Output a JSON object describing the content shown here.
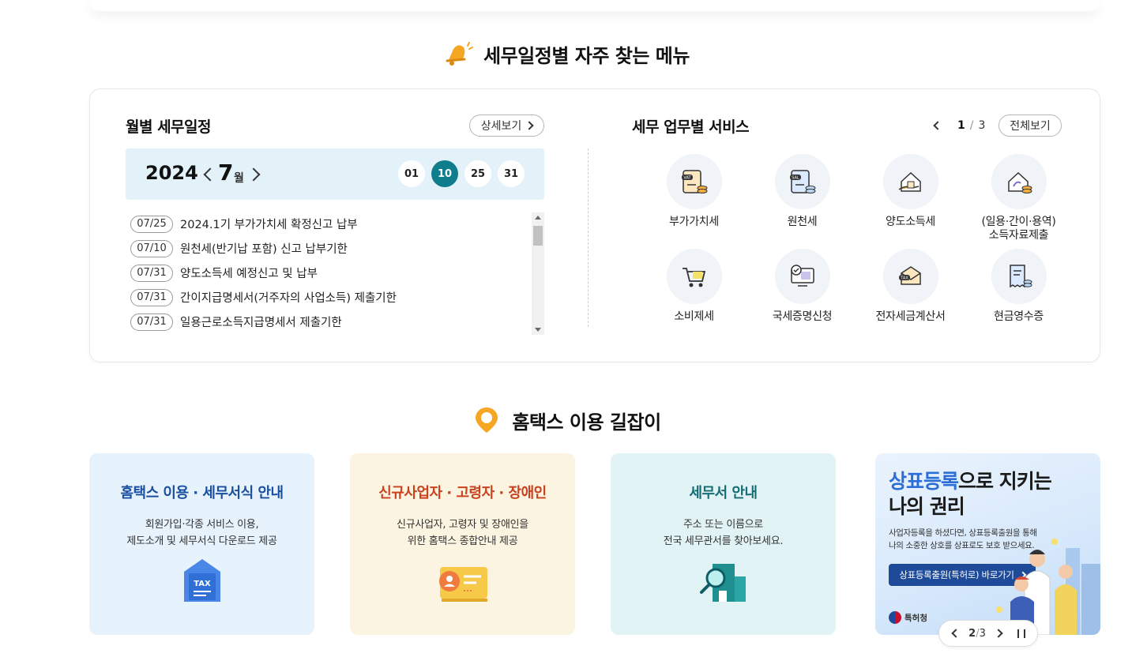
{
  "sections": {
    "schedule_title": "세무일정별 자주 찾는 메뉴",
    "guide_title": "홈택스 이용 길잡이"
  },
  "calendar": {
    "heading": "월별 세무일정",
    "detail_label": "상세보기",
    "year": "2024",
    "month": "7",
    "month_unit": "월",
    "days": [
      {
        "label": "01",
        "active": false
      },
      {
        "label": "10",
        "active": true
      },
      {
        "label": "25",
        "active": false
      },
      {
        "label": "31",
        "active": false
      }
    ],
    "items": [
      {
        "date": "07/25",
        "text": "2024.1기 부가가치세 확정신고 납부"
      },
      {
        "date": "07/10",
        "text": "원천세(반기납 포함) 신고 납부기한"
      },
      {
        "date": "07/31",
        "text": "양도소득세 예정신고 및 납부"
      },
      {
        "date": "07/31",
        "text": "간이지급명세서(거주자의 사업소득) 제출기한"
      },
      {
        "date": "07/31",
        "text": "일용근로소득지급명세서 제출기한"
      }
    ]
  },
  "services": {
    "heading": "세무 업무별 서비스",
    "page_current": "1",
    "page_total": "3",
    "all_label": "전체보기",
    "items": [
      {
        "label": "부가가치세",
        "icon": "vat-document-icon"
      },
      {
        "label": "원천세",
        "icon": "sal-document-icon"
      },
      {
        "label": "양도소득세",
        "icon": "house-hand-icon"
      },
      {
        "label": "(일용·간이·용역)\n소득자료제출",
        "icon": "house-coin-icon"
      },
      {
        "label": "소비제세",
        "icon": "cart-icon"
      },
      {
        "label": "국세증명신청",
        "icon": "certificate-monitor-icon"
      },
      {
        "label": "전자세금계산서",
        "icon": "tax-envelope-icon"
      },
      {
        "label": "현금영수증",
        "icon": "receipt-coin-icon"
      }
    ]
  },
  "guide": {
    "cards": [
      {
        "title": "홈택스 이용 · 세무서식 안내",
        "desc": "회원가입·각종 서비스 이용,\n제도소개 및 세무서식 다운로드 제공",
        "icon": "tax-folder-icon",
        "badge": "TAX"
      },
      {
        "title": "신규사업자 · 고령자 · 장애인",
        "desc": "신규사업자, 고령자 및 장애인을\n위한 홈택스 종합안내 제공",
        "icon": "id-card-icon"
      },
      {
        "title": "세무서 안내",
        "desc": "주소 또는 이름으로\n전국 세무관서를 찾아보세요.",
        "icon": "building-search-icon"
      }
    ]
  },
  "banner": {
    "title_highlight": "상표등록",
    "title_rest": "으로 지키는",
    "title_line2": "나의 권리",
    "desc": "사업자등록을 하셨다면, 상표등록출원을 통해\n나의 소중한 상호를 상표로도 보호 받으세요.",
    "button_label": "상표등록출원(특허로) 바로가기",
    "org": "특허청",
    "page_current": "2",
    "page_total": "3"
  },
  "colors": {
    "accent_teal": "#0f7d8c",
    "month_bar": "#e3f1f9",
    "card1_bg": "#e6f2fc",
    "card2_bg": "#fbf4e0",
    "card3_bg": "#e2f3f5",
    "banner_button": "#1d4a99"
  }
}
